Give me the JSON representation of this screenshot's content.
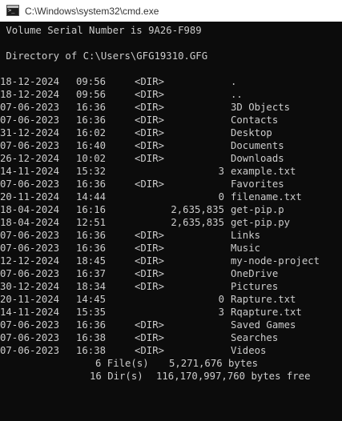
{
  "window": {
    "title": "C:\\Windows\\system32\\cmd.exe",
    "icon": "cmd-icon"
  },
  "console": {
    "volume_line": " Volume Serial Number is 9A26-F989",
    "directory_line": " Directory of C:\\Users\\GFG19310.GFG",
    "entries": [
      {
        "date": "18-12-2024",
        "time": "09:56",
        "type": "<DIR>",
        "size": "",
        "name": "."
      },
      {
        "date": "18-12-2024",
        "time": "09:56",
        "type": "<DIR>",
        "size": "",
        "name": ".."
      },
      {
        "date": "07-06-2023",
        "time": "16:36",
        "type": "<DIR>",
        "size": "",
        "name": "3D Objects"
      },
      {
        "date": "07-06-2023",
        "time": "16:36",
        "type": "<DIR>",
        "size": "",
        "name": "Contacts"
      },
      {
        "date": "31-12-2024",
        "time": "16:02",
        "type": "<DIR>",
        "size": "",
        "name": "Desktop"
      },
      {
        "date": "07-06-2023",
        "time": "16:40",
        "type": "<DIR>",
        "size": "",
        "name": "Documents"
      },
      {
        "date": "26-12-2024",
        "time": "10:02",
        "type": "<DIR>",
        "size": "",
        "name": "Downloads"
      },
      {
        "date": "14-11-2024",
        "time": "15:32",
        "type": "",
        "size": "3",
        "name": "example.txt"
      },
      {
        "date": "07-06-2023",
        "time": "16:36",
        "type": "<DIR>",
        "size": "",
        "name": "Favorites"
      },
      {
        "date": "20-11-2024",
        "time": "14:44",
        "type": "",
        "size": "0",
        "name": "filename.txt"
      },
      {
        "date": "18-04-2024",
        "time": "16:16",
        "type": "",
        "size": "2,635,835",
        "name": "get-pip.p"
      },
      {
        "date": "18-04-2024",
        "time": "12:51",
        "type": "",
        "size": "2,635,835",
        "name": "get-pip.py"
      },
      {
        "date": "07-06-2023",
        "time": "16:36",
        "type": "<DIR>",
        "size": "",
        "name": "Links"
      },
      {
        "date": "07-06-2023",
        "time": "16:36",
        "type": "<DIR>",
        "size": "",
        "name": "Music"
      },
      {
        "date": "12-12-2024",
        "time": "18:45",
        "type": "<DIR>",
        "size": "",
        "name": "my-node-project"
      },
      {
        "date": "07-06-2023",
        "time": "16:37",
        "type": "<DIR>",
        "size": "",
        "name": "OneDrive"
      },
      {
        "date": "30-12-2024",
        "time": "18:34",
        "type": "<DIR>",
        "size": "",
        "name": "Pictures"
      },
      {
        "date": "20-11-2024",
        "time": "14:45",
        "type": "",
        "size": "0",
        "name": "Rapture.txt"
      },
      {
        "date": "14-11-2024",
        "time": "15:35",
        "type": "",
        "size": "3",
        "name": "Rqapture.txt"
      },
      {
        "date": "07-06-2023",
        "time": "16:36",
        "type": "<DIR>",
        "size": "",
        "name": "Saved Games"
      },
      {
        "date": "07-06-2023",
        "time": "16:38",
        "type": "<DIR>",
        "size": "",
        "name": "Searches"
      },
      {
        "date": "07-06-2023",
        "time": "16:38",
        "type": "<DIR>",
        "size": "",
        "name": "Videos"
      }
    ],
    "summary": {
      "files_label": "6 File(s)",
      "files_bytes": "5,271,676 bytes",
      "dirs_label": "16 Dir(s)",
      "dirs_bytes": "116,170,997,760 bytes free"
    }
  }
}
